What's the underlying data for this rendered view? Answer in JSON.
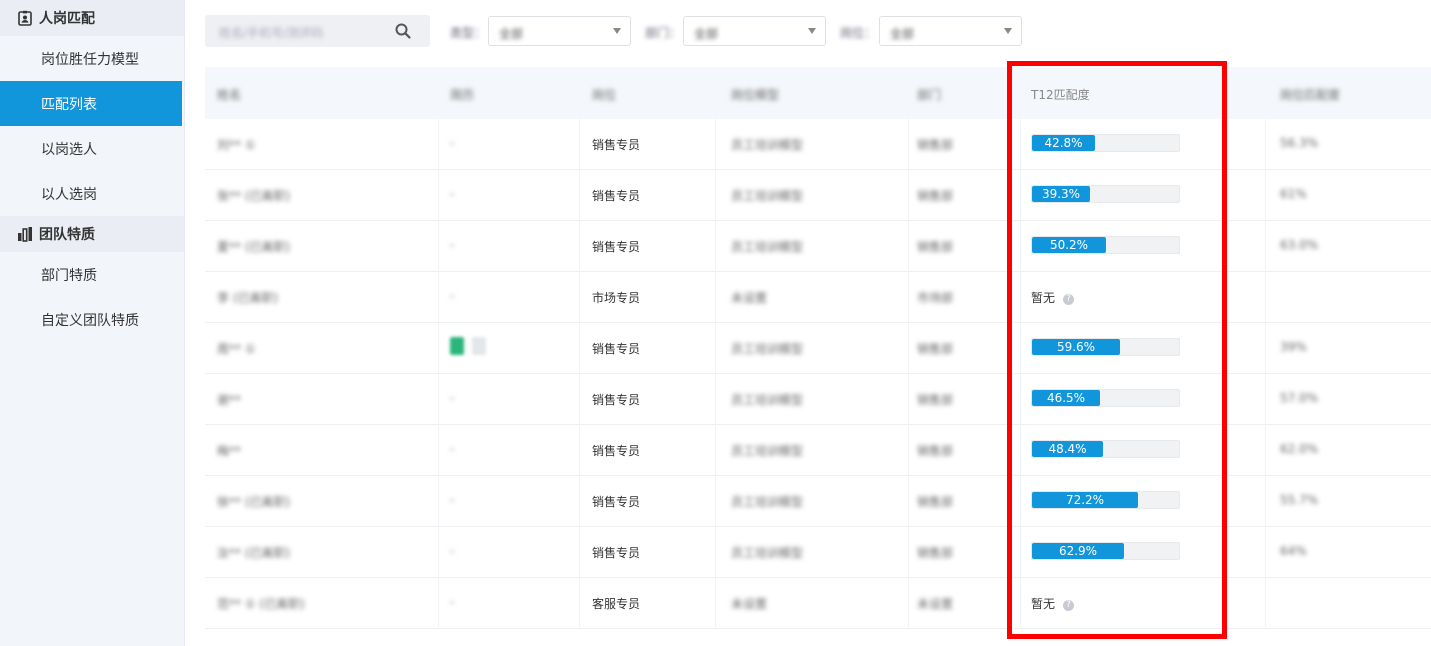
{
  "sidebar": {
    "groups": [
      {
        "title": "人岗匹配",
        "icon": "person-badge-icon",
        "items": [
          {
            "label": "岗位胜任力模型",
            "active": false
          },
          {
            "label": "匹配列表",
            "active": true
          },
          {
            "label": "以岗选人",
            "active": false
          },
          {
            "label": "以人选岗",
            "active": false
          }
        ]
      },
      {
        "title": "团队特质",
        "icon": "bar-chart-icon",
        "items": [
          {
            "label": "部门特质",
            "active": false
          },
          {
            "label": "自定义团队特质",
            "active": false
          }
        ]
      }
    ]
  },
  "filters": {
    "search_placeholder": "姓名/手机号/测评码",
    "type_label": "类型：",
    "type_value": "全部",
    "dept_label": "部门：",
    "dept_value": "全部",
    "post_label": "岗位：",
    "post_value": "全部"
  },
  "table": {
    "headers": [
      "姓名",
      "简历",
      "岗位",
      "岗位模型",
      "部门",
      "T12匹配度",
      "岗位匹配度"
    ],
    "rows": [
      {
        "name": "刘** ①",
        "resume": "-",
        "post": "销售专员",
        "model": "员工培训模型",
        "dept": "销售部",
        "t12": "42.8%",
        "t12_value": 42.8,
        "other": "56.3%"
      },
      {
        "name": "张** (已离职)",
        "resume": "-",
        "post": "销售专员",
        "model": "员工培训模型",
        "dept": "销售部",
        "t12": "39.3%",
        "t12_value": 39.3,
        "other": "61%"
      },
      {
        "name": "夏** (已离职)",
        "resume": "-",
        "post": "销售专员",
        "model": "员工培训模型",
        "dept": "销售部",
        "t12": "50.2%",
        "t12_value": 50.2,
        "other": "63.0%"
      },
      {
        "name": "李 (已离职)",
        "resume": "-",
        "post": "市场专员",
        "model": "未设置",
        "dept": "市场部",
        "t12": "暂无",
        "t12_value": null,
        "other": ""
      },
      {
        "name": "周** ①",
        "resume": "docs",
        "post": "销售专员",
        "model": "员工培训模型",
        "dept": "销售部",
        "t12": "59.6%",
        "t12_value": 59.6,
        "other": "39%"
      },
      {
        "name": "谢**",
        "resume": "-",
        "post": "销售专员",
        "model": "员工培训模型",
        "dept": "销售部",
        "t12": "46.5%",
        "t12_value": 46.5,
        "other": "57.0%"
      },
      {
        "name": "梅**",
        "resume": "-",
        "post": "销售专员",
        "model": "员工培训模型",
        "dept": "销售部",
        "t12": "48.4%",
        "t12_value": 48.4,
        "other": "62.0%"
      },
      {
        "name": "徐** (已离职)",
        "resume": "-",
        "post": "销售专员",
        "model": "员工培训模型",
        "dept": "销售部",
        "t12": "72.2%",
        "t12_value": 72.2,
        "other": "55.7%"
      },
      {
        "name": "汝** (已离职)",
        "resume": "-",
        "post": "销售专员",
        "model": "员工培训模型",
        "dept": "销售部",
        "t12": "62.9%",
        "t12_value": 62.9,
        "other": "64%"
      },
      {
        "name": "范** ① (已离职)",
        "resume": "-",
        "post": "客服专员",
        "model": "未设置",
        "dept": "未设置",
        "t12": "暂无",
        "t12_value": null,
        "other": ""
      }
    ]
  },
  "colors": {
    "accent": "#1296db",
    "highlight": "#ff0000",
    "sidebar_bg": "#f2f5fa"
  }
}
